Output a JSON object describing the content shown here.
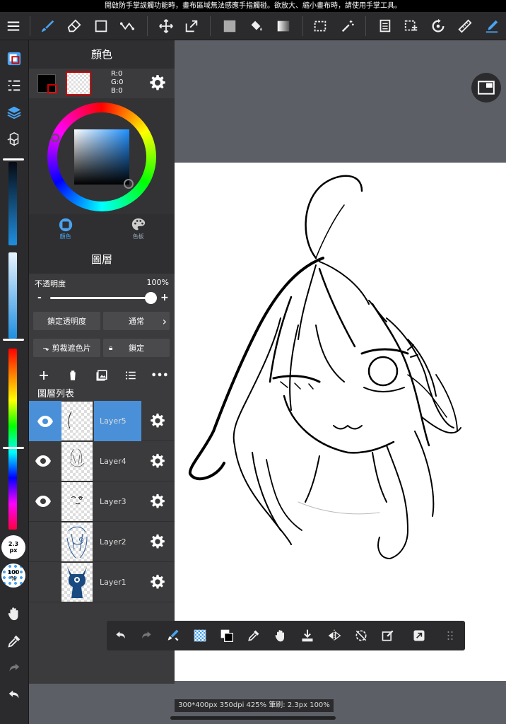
{
  "notice": "開啟防手掌誤觸功能時，畫布區域無法感應手指觸碰。欲放大、縮小畫布時，請使用手掌工具。",
  "color_panel": {
    "title": "顏色",
    "rgb_r": "R:0",
    "rgb_g": "G:0",
    "rgb_b": "B:0",
    "tab_color": "顏色",
    "tab_palette": "色板",
    "foreground": "#000000",
    "background_swatch": "transparent"
  },
  "layer_panel": {
    "title": "圖層",
    "opacity_label": "不透明度",
    "opacity_value": "100%",
    "opacity_fraction": 1.0,
    "minus": "-",
    "plus": "+",
    "lock_alpha": "鎖定透明度",
    "blend_mode": "通常",
    "clipping": "剪裁遮色片",
    "lock": "鎖定",
    "list_title": "圖層列表",
    "more": "•••",
    "layers": [
      {
        "name": "Layer5",
        "selected": true,
        "visible": true
      },
      {
        "name": "Layer4",
        "selected": false,
        "visible": true
      },
      {
        "name": "Layer3",
        "selected": false,
        "visible": true
      },
      {
        "name": "Layer2",
        "selected": false,
        "visible": false
      },
      {
        "name": "Layer1",
        "selected": false,
        "visible": false
      }
    ]
  },
  "brush": {
    "size": "2.3",
    "size_unit": "px",
    "opacity": "100",
    "opacity_unit": "%"
  },
  "status": "300*400px 350dpi 425% 筆刷: 2.3px 100%",
  "colors": {
    "accent": "#4a90d9",
    "toolbar_bg": "#2b2b2d",
    "panel_bg": "#3b3b3d",
    "canvas_bg": "#5c6066"
  }
}
